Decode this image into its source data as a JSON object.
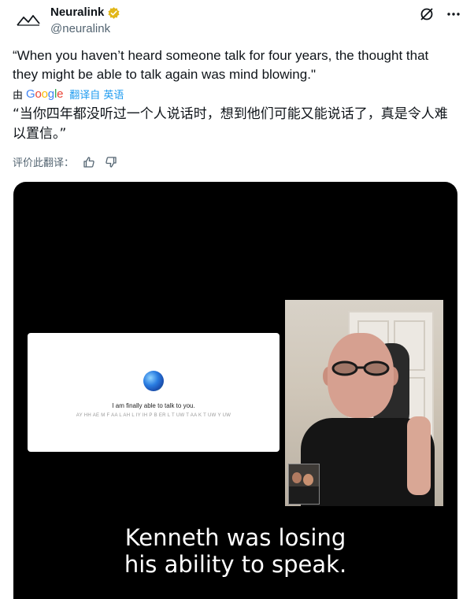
{
  "author": {
    "display_name": "Neuralink",
    "handle": "@neuralink",
    "avatar_icon": "neuralink-logo-icon",
    "verified_color": "#e2b719"
  },
  "top_actions": {
    "grok_icon": "grok-icon",
    "more_icon": "more-icon"
  },
  "tweet": {
    "text": "“When you haven’t heard someone talk for four years, the thought that they might be able to talk again was mind blowing.\"",
    "translated_by_prefix": "由",
    "translate_link": "翻译自 英语",
    "translated_text": "“当你四年都没听过一个人说话时，想到他们可能又能说话了，真是令人难以置信。”",
    "rate_label": "评价此翻译：",
    "google": {
      "letters": [
        "G",
        "o",
        "o",
        "g",
        "l",
        "e"
      ],
      "colors": [
        "#4285F4",
        "#EA4335",
        "#FBBC05",
        "#4285F4",
        "#34A853",
        "#EA4335"
      ]
    }
  },
  "media": {
    "card_text": "I am finally able to talk to you.",
    "card_phonemes": "AY HH AE M F AA L AH L IY IH P B ER L T UW T AA K T UW Y UW",
    "caption_line1": "Kenneth was losing",
    "caption_line2": "his ability to speak.",
    "background": "#000000"
  },
  "colors": {
    "link": "#1d9bf0",
    "secondary_text": "#536471"
  }
}
